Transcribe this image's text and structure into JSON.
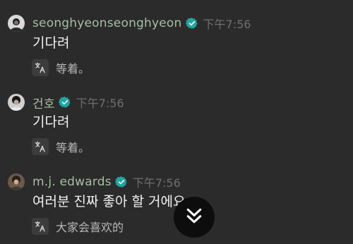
{
  "messages": [
    {
      "username": "seonghyeonseonghyeon",
      "avatar": "avatar-seonghyeon",
      "verified": true,
      "time": "下午7:56",
      "text": "기다려",
      "translation": "等着。"
    },
    {
      "username": "건호",
      "avatar": "avatar-geonho",
      "verified": true,
      "time": "下午7:56",
      "text": "기다려",
      "translation": "等着。"
    },
    {
      "username": "m.j. edwards",
      "avatar": "avatar-mj-edwards",
      "verified": true,
      "time": "下午7:56",
      "text": "여러분 진짜 좋아 할 거에요",
      "translation": "大家会喜欢的"
    }
  ],
  "icons": {
    "verified": "verified-badge-icon",
    "translate": "translate-icon",
    "scroll": "double-chevron-down-icon"
  },
  "colors": {
    "background": "#2b2b2b",
    "username": "#a8bfa3",
    "timestamp": "#6f6f6f",
    "verified": "#1fa6a0",
    "scroll_button": "#0d0d0d"
  }
}
